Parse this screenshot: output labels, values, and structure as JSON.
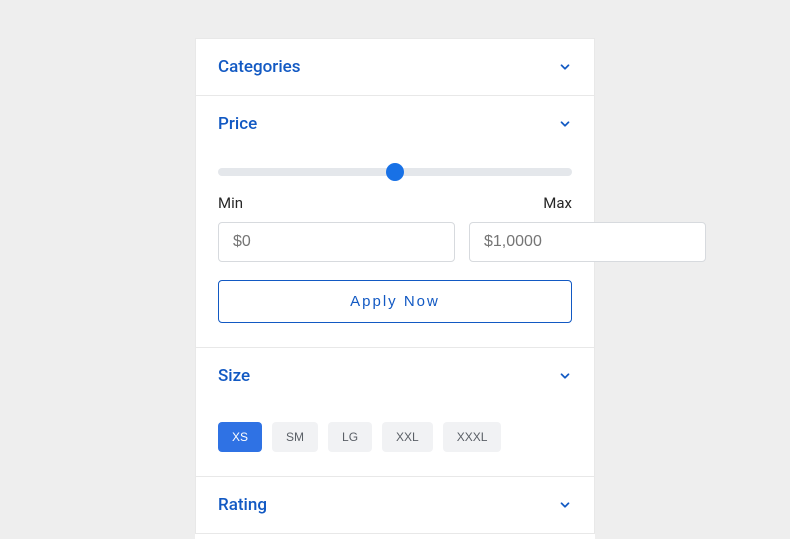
{
  "categories": {
    "title": "Categories"
  },
  "price": {
    "title": "Price",
    "min_label": "Min",
    "max_label": "Max",
    "min_placeholder": "$0",
    "max_placeholder": "$1,0000",
    "apply_label": "Apply Now",
    "slider_value": 50
  },
  "size": {
    "title": "Size",
    "options": [
      "XS",
      "SM",
      "LG",
      "XXL",
      "XXXL"
    ],
    "active": "XS"
  },
  "rating": {
    "title": "Rating"
  }
}
